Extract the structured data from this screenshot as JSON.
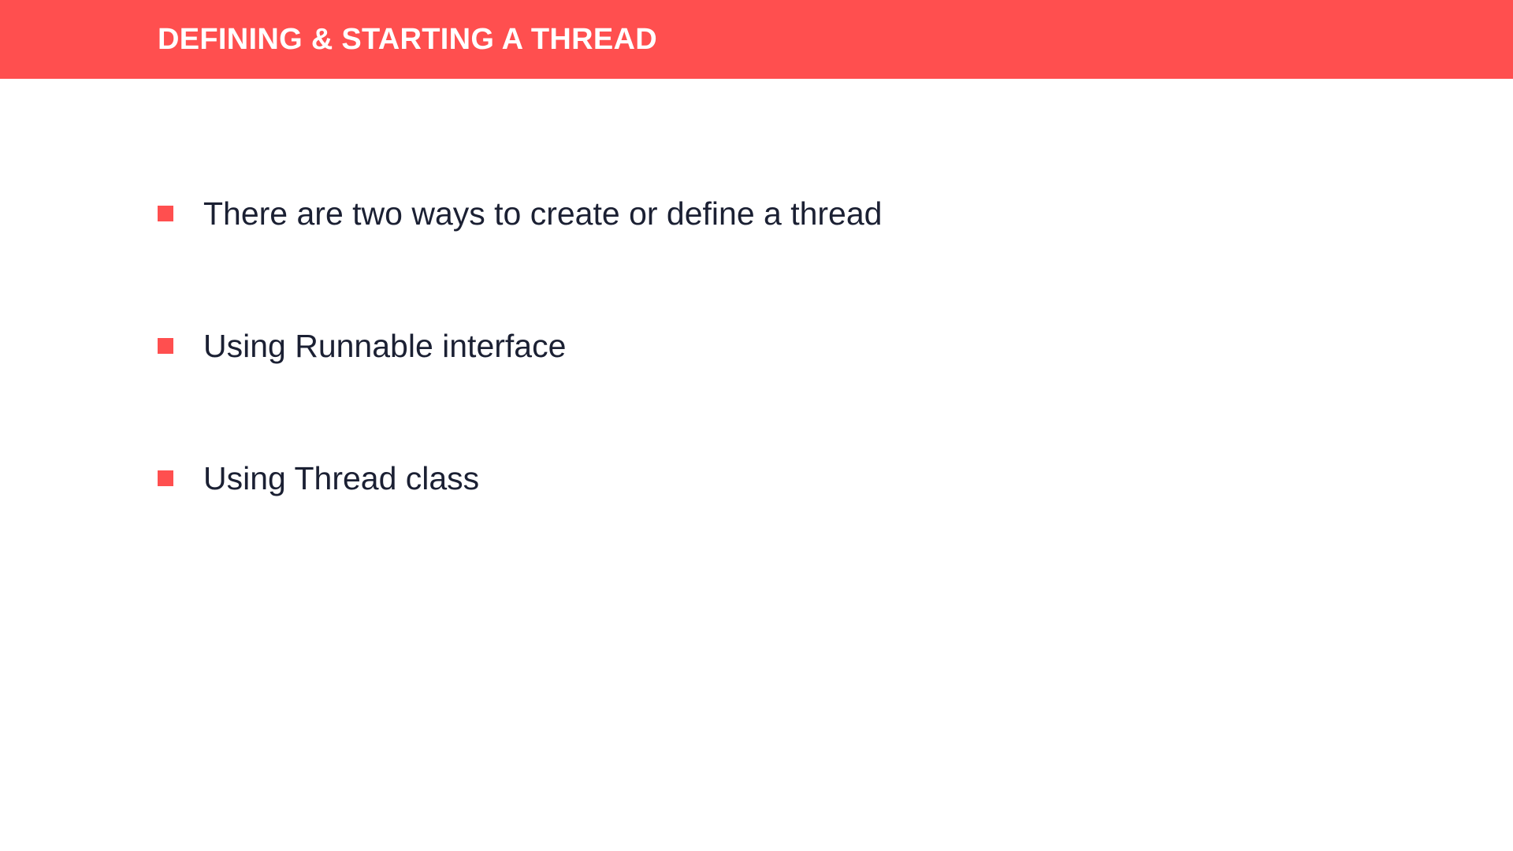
{
  "header": {
    "title": "DEFINING & STARTING A THREAD"
  },
  "bullets": [
    {
      "text": "There are two ways to create or define a thread"
    },
    {
      "text": "Using Runnable interface"
    },
    {
      "text": "Using Thread class"
    }
  ],
  "colors": {
    "accent": "#ff4f4f",
    "title_text": "#ffffff",
    "body_text": "#1b2033",
    "background": "#ffffff"
  }
}
